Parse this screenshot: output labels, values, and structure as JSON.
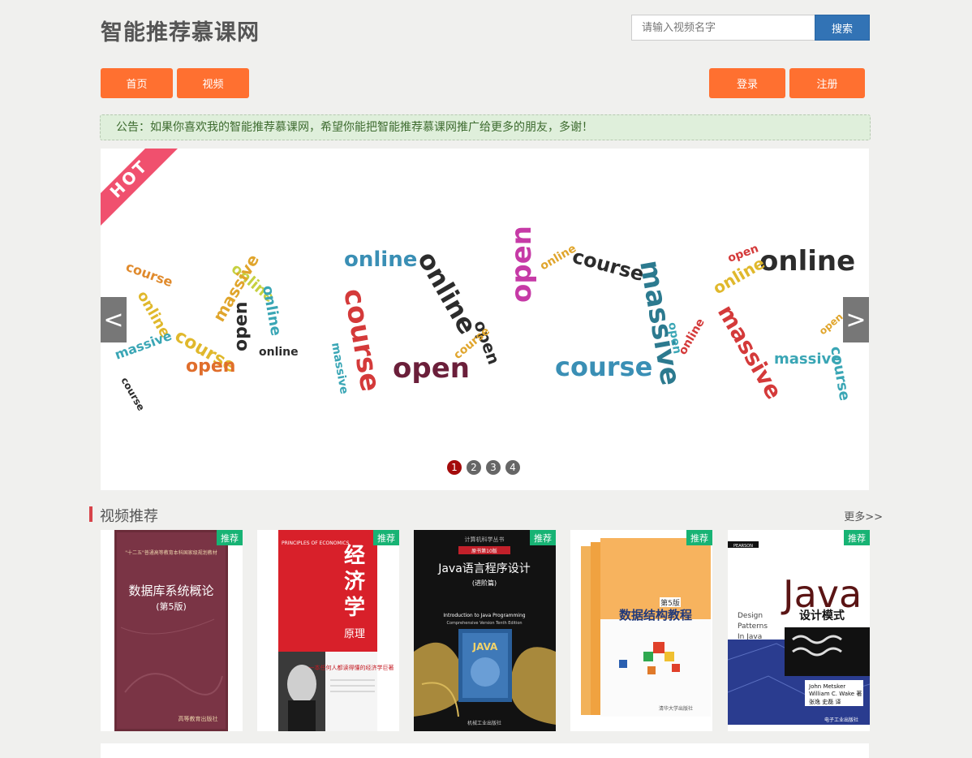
{
  "header": {
    "site_title": "智能推荐慕课网",
    "search_placeholder": "请输入视频名字",
    "search_button": "搜索"
  },
  "nav": {
    "home": "首页",
    "video": "视频",
    "login": "登录",
    "register": "注册"
  },
  "notice": "公告：如果你喜欢我的智能推荐慕课网，希望你能把智能推荐慕课网推广给更多的朋友，多谢！",
  "carousel": {
    "ribbon_text": "HOT",
    "prev_label": "<",
    "next_label": ">",
    "dots": [
      "1",
      "2",
      "3",
      "4"
    ],
    "active_dot": 1,
    "words": [
      "online",
      "course",
      "open",
      "massive"
    ]
  },
  "recommend": {
    "title": "视频推荐",
    "more": "更多>>",
    "badge": "推荐",
    "cards": [
      {
        "book_top": "\"十二五\"普通高等教育本科国家级规划教材",
        "book_title": "数据库系统概论",
        "book_edition": "(第5版)",
        "publisher": "高等教育出版社"
      },
      {
        "book_top": "PRINCIPLES OF ECONOMICS",
        "book_title_1": "经",
        "book_title_2": "济",
        "book_title_3": "学",
        "book_subtitle": "原理",
        "book_caption": "一本任何人都读得懂的经济学巨著"
      },
      {
        "book_series": "计算机科学丛书",
        "book_edition": "原书第10版",
        "book_title": "Java语言程序设计",
        "book_subtitle": "(进阶篇)",
        "book_en": "Introduction to Java Programming",
        "book_en_sub": "Comprehensive Version Tenth Edition",
        "book_logo": "JAVA",
        "publisher": "机械工业出版社"
      },
      {
        "book_edition": "第5版",
        "book_title": "数据结构教程",
        "publisher": "清华大学出版社"
      },
      {
        "book_brand": "PEARSON",
        "book_en1": "Design",
        "book_en2": "Patterns",
        "book_en3": "In Java",
        "book_logo": "Java",
        "book_title": "设计模式",
        "book_author": "John Metsker",
        "book_author2": "William C. Wake 著",
        "book_translator": "张逸 史磊 译",
        "publisher": "电子工业出版社"
      }
    ]
  }
}
